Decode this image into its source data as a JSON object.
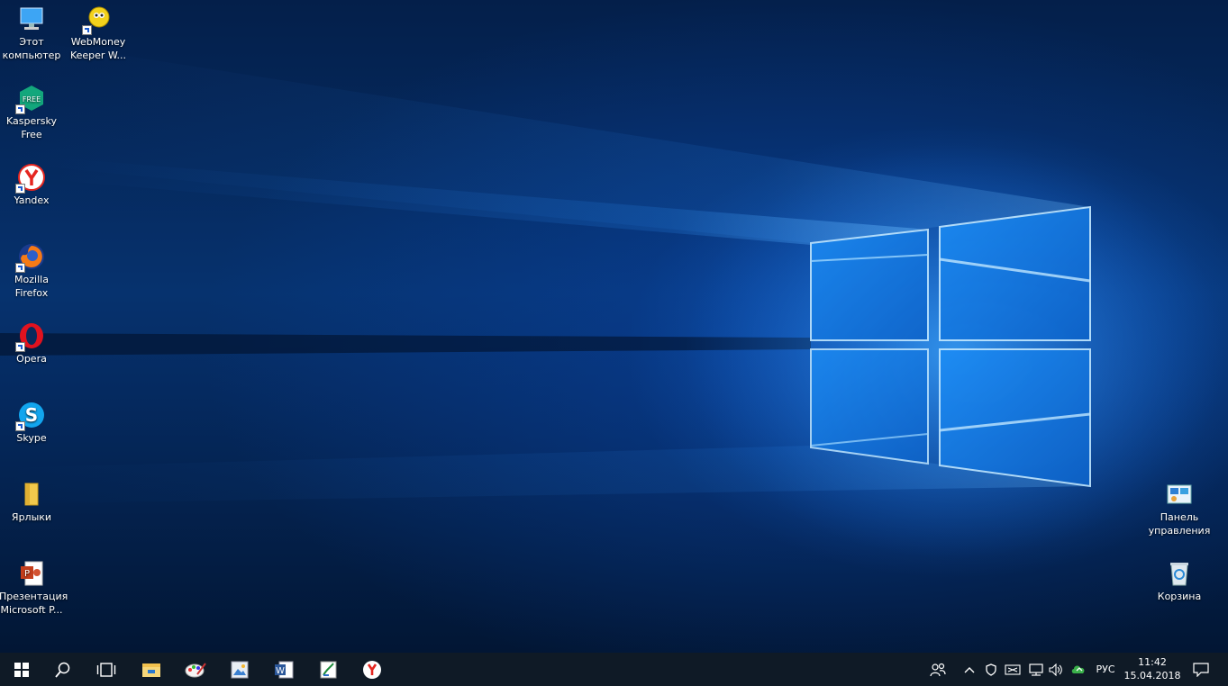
{
  "desktop": {
    "icons_left": [
      {
        "label": "Этот\nкомпьютер",
        "icon": "this-pc-icon"
      },
      {
        "label": "WebMoney\nKeeper W...",
        "icon": "webmoney-icon"
      },
      {
        "label": "Kaspersky\nFree",
        "icon": "kaspersky-icon"
      },
      {
        "label": "Yandex",
        "icon": "yandex-browser-icon"
      },
      {
        "label": "Mozilla\nFirefox",
        "icon": "firefox-icon"
      },
      {
        "label": "Opera",
        "icon": "opera-icon"
      },
      {
        "label": "Skype",
        "icon": "skype-icon"
      },
      {
        "label": "Ярлыки",
        "icon": "folder-icon"
      },
      {
        "label": "Презентация\nMicrosoft P...",
        "icon": "powerpoint-file-icon"
      }
    ],
    "icons_right": [
      {
        "label": "Панель\nуправления",
        "icon": "control-panel-icon"
      },
      {
        "label": "Корзина",
        "icon": "recycle-bin-icon"
      }
    ]
  },
  "taskbar": {
    "pinned": [
      "start-icon",
      "search-icon",
      "task-view-icon",
      "file-explorer-icon",
      "paint-icon",
      "photos-icon",
      "word-icon",
      "app-icon",
      "yandex-browser-icon"
    ],
    "tray": {
      "language": "РУС",
      "time": "11:42",
      "date": "15.04.2018"
    }
  },
  "colors": {
    "accent": "#1e90ff",
    "taskbar": "#0f1a26"
  }
}
